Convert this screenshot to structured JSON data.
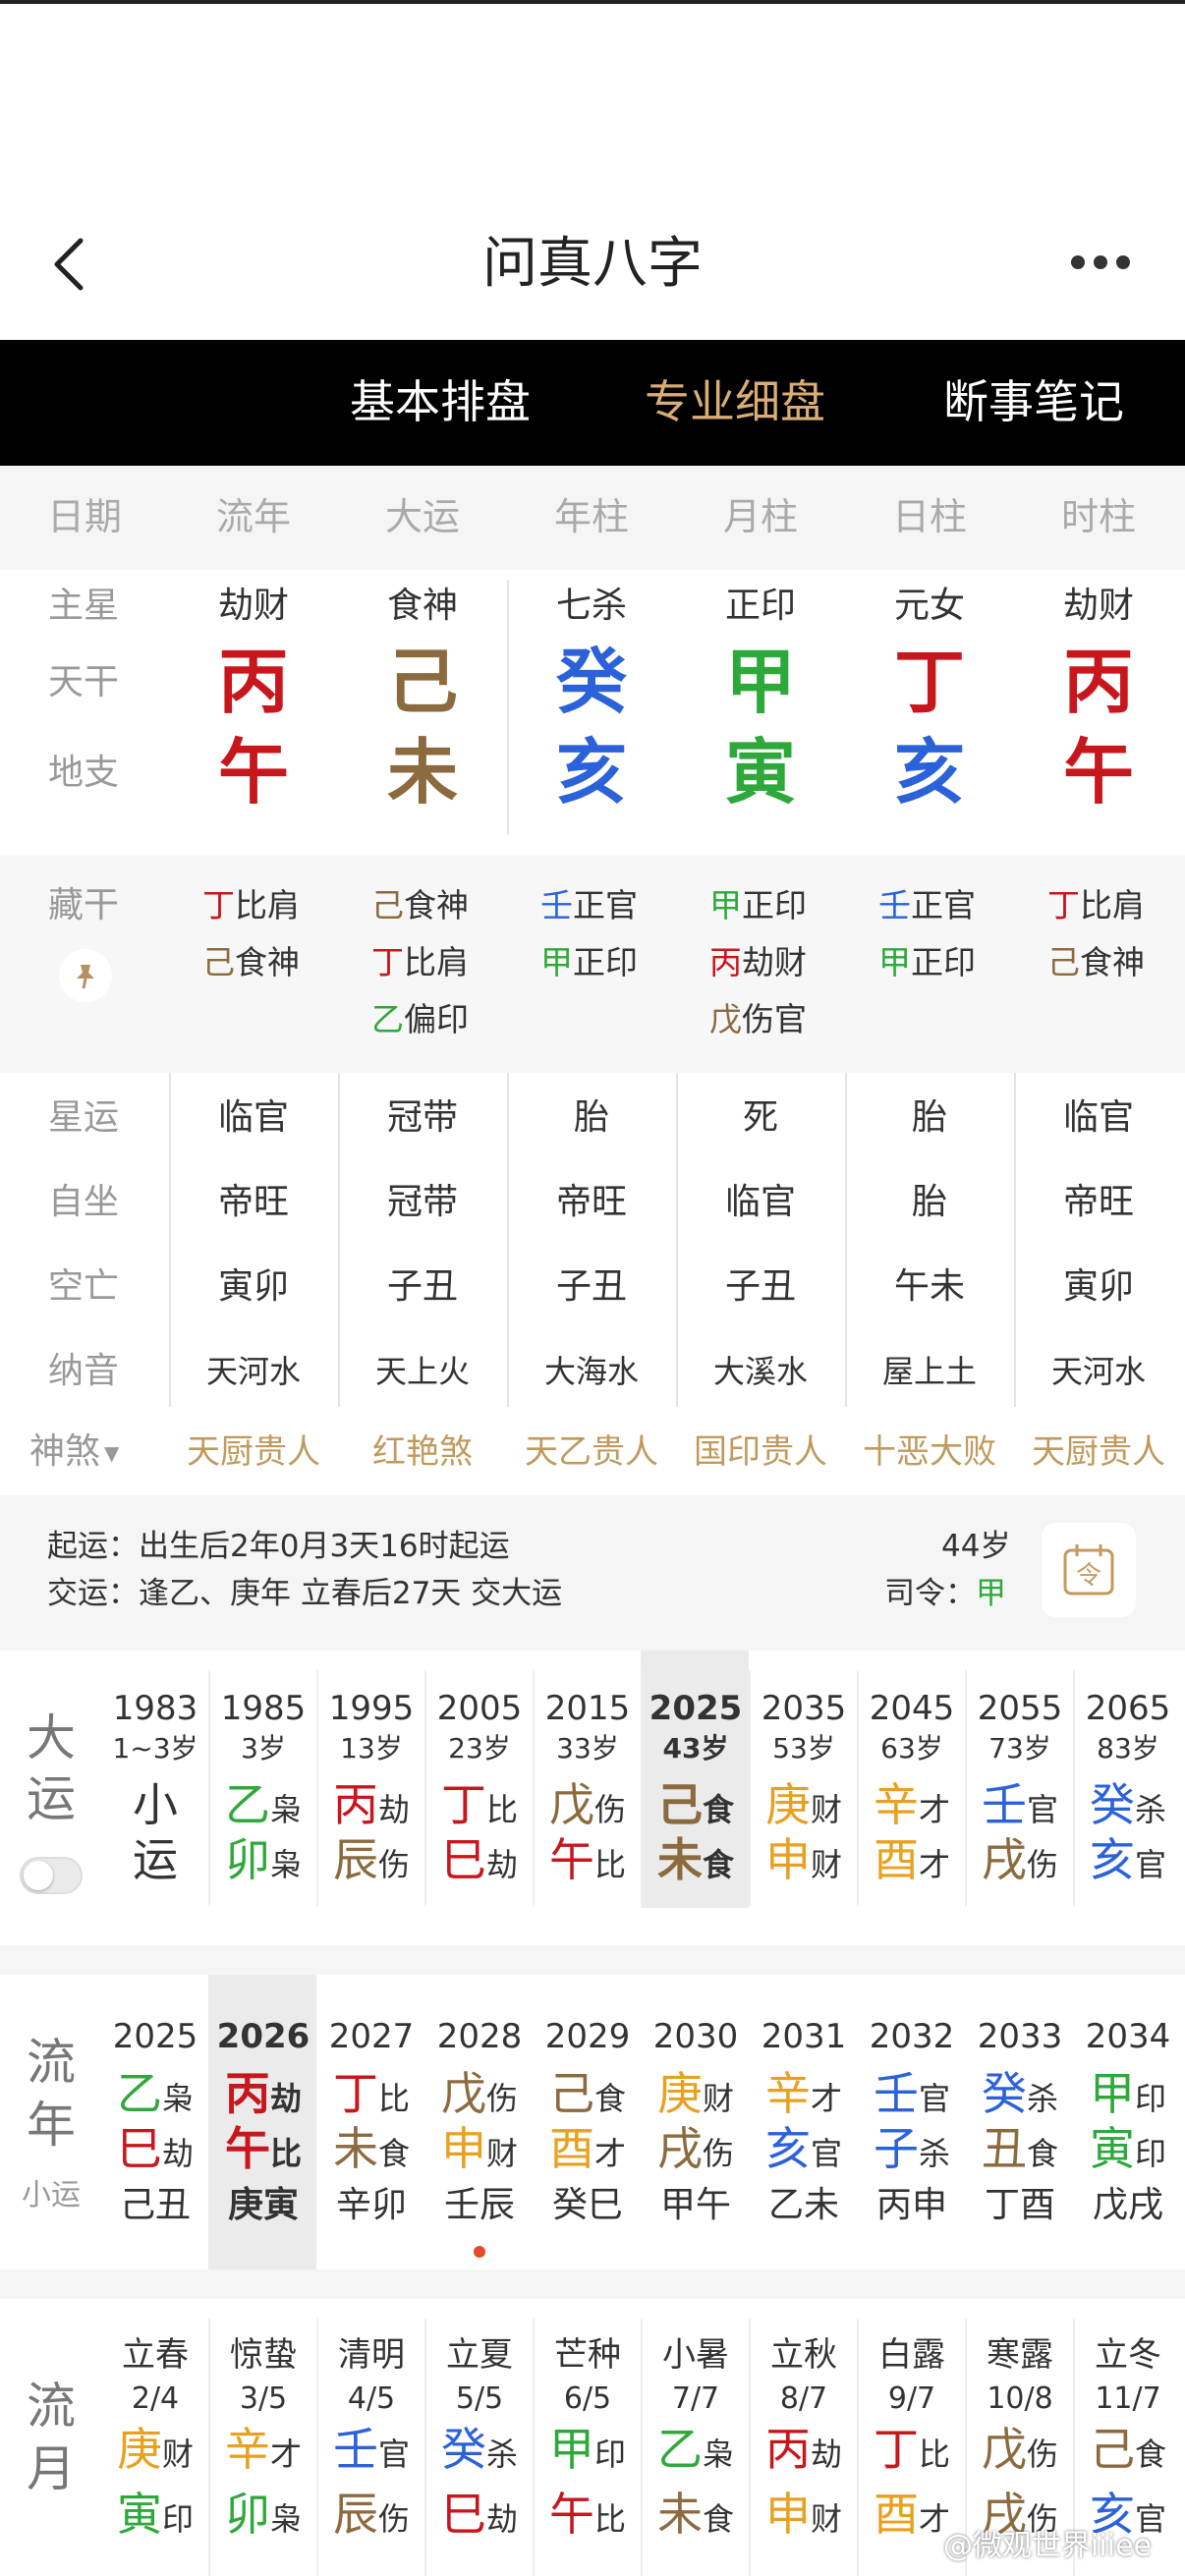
{
  "app_title": "问真八字",
  "tabs": [
    {
      "label": "",
      "active": false
    },
    {
      "label": "基本排盘",
      "active": false
    },
    {
      "label": "专业细盘",
      "active": true
    },
    {
      "label": "断事笔记",
      "active": false
    }
  ],
  "header": [
    "日期",
    "流年",
    "大运",
    "年柱",
    "月柱",
    "日柱",
    "时柱"
  ],
  "row_labels": {
    "zhuxing": "主星",
    "tiangan": "天干",
    "dizhi": "地支",
    "canggan": "藏干",
    "xingyun": "星运",
    "zizuo": "自坐",
    "kongwang": "空亡",
    "nayin": "纳音",
    "shensha": "神煞"
  },
  "pillars": [
    {
      "star": "劫财",
      "stem": "丙",
      "stem_color": "#c8161d",
      "branch": "午",
      "branch_color": "#c8161d"
    },
    {
      "star": "食神",
      "stem": "己",
      "stem_color": "#8b6a3e",
      "branch": "未",
      "branch_color": "#8b6a3e"
    },
    {
      "star": "七杀",
      "stem": "癸",
      "stem_color": "#2b62d9",
      "branch": "亥",
      "branch_color": "#2b62d9"
    },
    {
      "star": "正印",
      "stem": "甲",
      "stem_color": "#2ea83a",
      "branch": "寅",
      "branch_color": "#2ea83a"
    },
    {
      "star": "元女",
      "stem": "丁",
      "stem_color": "#c8161d",
      "branch": "亥",
      "branch_color": "#2b62d9"
    },
    {
      "star": "劫财",
      "stem": "丙",
      "stem_color": "#c8161d",
      "branch": "午",
      "branch_color": "#c8161d"
    }
  ],
  "hidden_stems": [
    [
      {
        "g": "丁",
        "c": "#c8161d",
        "t": "比肩"
      },
      {
        "g": "己",
        "c": "#8b6a3e",
        "t": "食神"
      }
    ],
    [
      {
        "g": "己",
        "c": "#8b6a3e",
        "t": "食神"
      },
      {
        "g": "丁",
        "c": "#c8161d",
        "t": "比肩"
      },
      {
        "g": "乙",
        "c": "#2ea83a",
        "t": "偏印"
      }
    ],
    [
      {
        "g": "壬",
        "c": "#2b62d9",
        "t": "正官"
      },
      {
        "g": "甲",
        "c": "#2ea83a",
        "t": "正印"
      }
    ],
    [
      {
        "g": "甲",
        "c": "#2ea83a",
        "t": "正印"
      },
      {
        "g": "丙",
        "c": "#c8161d",
        "t": "劫财"
      },
      {
        "g": "戊",
        "c": "#8b6a3e",
        "t": "伤官"
      }
    ],
    [
      {
        "g": "壬",
        "c": "#2b62d9",
        "t": "正官"
      },
      {
        "g": "甲",
        "c": "#2ea83a",
        "t": "正印"
      }
    ],
    [
      {
        "g": "丁",
        "c": "#c8161d",
        "t": "比肩"
      },
      {
        "g": "己",
        "c": "#8b6a3e",
        "t": "食神"
      }
    ]
  ],
  "xingyun": [
    "临官",
    "冠带",
    "胎",
    "死",
    "胎",
    "临官"
  ],
  "zizuo": [
    "帝旺",
    "冠带",
    "帝旺",
    "临官",
    "胎",
    "帝旺"
  ],
  "kongwang": [
    "寅卯",
    "子丑",
    "子丑",
    "子丑",
    "午未",
    "寅卯"
  ],
  "nayin": [
    "天河水",
    "天上火",
    "大海水",
    "大溪水",
    "屋上土",
    "天河水"
  ],
  "shensha": [
    "天厨贵人",
    "红艳煞",
    "天乙贵人",
    "国印贵人",
    "十恶大败",
    "天厨贵人"
  ],
  "qiyun": {
    "line1": "起运：出生后2年0月3天16时起运",
    "line2": "交运：逢乙、庚年 立春后27天 交大运",
    "age": "44岁",
    "siling_label": "司令：",
    "siling_value": "甲",
    "button_char": "令"
  },
  "dayun": {
    "side_label": [
      "大",
      "运"
    ],
    "items": [
      {
        "year": "1983",
        "age": "1~3岁",
        "xiaoyun": [
          "小",
          "运"
        ]
      },
      {
        "year": "1985",
        "age": "3岁",
        "g": "乙",
        "gc": "#2ea83a",
        "gt": "枭",
        "z": "卯",
        "zc": "#2ea83a",
        "zt": "枭"
      },
      {
        "year": "1995",
        "age": "13岁",
        "g": "丙",
        "gc": "#c8161d",
        "gt": "劫",
        "z": "辰",
        "zc": "#8b6a3e",
        "zt": "伤"
      },
      {
        "year": "2005",
        "age": "23岁",
        "g": "丁",
        "gc": "#c8161d",
        "gt": "比",
        "z": "巳",
        "zc": "#c8161d",
        "zt": "劫"
      },
      {
        "year": "2015",
        "age": "33岁",
        "g": "戊",
        "gc": "#8b6a3e",
        "gt": "伤",
        "z": "午",
        "zc": "#c8161d",
        "zt": "比"
      },
      {
        "year": "2025",
        "age": "43岁",
        "g": "己",
        "gc": "#8b6a3e",
        "gt": "食",
        "z": "未",
        "zc": "#8b6a3e",
        "zt": "食",
        "current": true
      },
      {
        "year": "2035",
        "age": "53岁",
        "g": "庚",
        "gc": "#e8a020",
        "gt": "财",
        "z": "申",
        "zc": "#e8a020",
        "zt": "财"
      },
      {
        "year": "2045",
        "age": "63岁",
        "g": "辛",
        "gc": "#e8a020",
        "gt": "才",
        "z": "酉",
        "zc": "#e8a020",
        "zt": "才"
      },
      {
        "year": "2055",
        "age": "73岁",
        "g": "壬",
        "gc": "#2b62d9",
        "gt": "官",
        "z": "戌",
        "zc": "#8b6a3e",
        "zt": "伤"
      },
      {
        "year": "2065",
        "age": "83岁",
        "g": "癸",
        "gc": "#2b62d9",
        "gt": "杀",
        "z": "亥",
        "zc": "#2b62d9",
        "zt": "官"
      }
    ]
  },
  "liunian": {
    "side_label": [
      "流",
      "年"
    ],
    "side_sub": "小运",
    "items": [
      {
        "year": "2025",
        "g": "乙",
        "gc": "#2ea83a",
        "gt": "枭",
        "z": "巳",
        "zc": "#c8161d",
        "zt": "劫",
        "xy": "己丑"
      },
      {
        "year": "2026",
        "g": "丙",
        "gc": "#c8161d",
        "gt": "劫",
        "z": "午",
        "zc": "#c8161d",
        "zt": "比",
        "xy": "庚寅",
        "current": true
      },
      {
        "year": "2027",
        "g": "丁",
        "gc": "#c8161d",
        "gt": "比",
        "z": "未",
        "zc": "#8b6a3e",
        "zt": "食",
        "xy": "辛卯"
      },
      {
        "year": "2028",
        "g": "戊",
        "gc": "#8b6a3e",
        "gt": "伤",
        "z": "申",
        "zc": "#e8a020",
        "zt": "财",
        "xy": "壬辰",
        "dot": true
      },
      {
        "year": "2029",
        "g": "己",
        "gc": "#8b6a3e",
        "gt": "食",
        "z": "酉",
        "zc": "#e8a020",
        "zt": "才",
        "xy": "癸巳"
      },
      {
        "year": "2030",
        "g": "庚",
        "gc": "#e8a020",
        "gt": "财",
        "z": "戌",
        "zc": "#8b6a3e",
        "zt": "伤",
        "xy": "甲午"
      },
      {
        "year": "2031",
        "g": "辛",
        "gc": "#e8a020",
        "gt": "才",
        "z": "亥",
        "zc": "#2b62d9",
        "zt": "官",
        "xy": "乙未"
      },
      {
        "year": "2032",
        "g": "壬",
        "gc": "#2b62d9",
        "gt": "官",
        "z": "子",
        "zc": "#2b62d9",
        "zt": "杀",
        "xy": "丙申"
      },
      {
        "year": "2033",
        "g": "癸",
        "gc": "#2b62d9",
        "gt": "杀",
        "z": "丑",
        "zc": "#8b6a3e",
        "zt": "食",
        "xy": "丁酉"
      },
      {
        "year": "2034",
        "g": "甲",
        "gc": "#2ea83a",
        "gt": "印",
        "z": "寅",
        "zc": "#2ea83a",
        "zt": "印",
        "xy": "戊戌"
      }
    ]
  },
  "liuyue": {
    "side_label": [
      "流",
      "月"
    ],
    "items": [
      {
        "term": "立春",
        "date": "2/4",
        "g": "庚",
        "gc": "#e8a020",
        "gt": "财",
        "z": "寅",
        "zc": "#2ea83a",
        "zt": "印"
      },
      {
        "term": "惊蛰",
        "date": "3/5",
        "g": "辛",
        "gc": "#e8a020",
        "gt": "才",
        "z": "卯",
        "zc": "#2ea83a",
        "zt": "枭"
      },
      {
        "term": "清明",
        "date": "4/5",
        "g": "壬",
        "gc": "#2b62d9",
        "gt": "官",
        "z": "辰",
        "zc": "#8b6a3e",
        "zt": "伤"
      },
      {
        "term": "立夏",
        "date": "5/5",
        "g": "癸",
        "gc": "#2b62d9",
        "gt": "杀",
        "z": "巳",
        "zc": "#c8161d",
        "zt": "劫"
      },
      {
        "term": "芒种",
        "date": "6/5",
        "g": "甲",
        "gc": "#2ea83a",
        "gt": "印",
        "z": "午",
        "zc": "#c8161d",
        "zt": "比"
      },
      {
        "term": "小暑",
        "date": "7/7",
        "g": "乙",
        "gc": "#2ea83a",
        "gt": "枭",
        "z": "未",
        "zc": "#8b6a3e",
        "zt": "食"
      },
      {
        "term": "立秋",
        "date": "8/7",
        "g": "丙",
        "gc": "#c8161d",
        "gt": "劫",
        "z": "申",
        "zc": "#e8a020",
        "zt": "财"
      },
      {
        "term": "白露",
        "date": "9/7",
        "g": "丁",
        "gc": "#c8161d",
        "gt": "比",
        "z": "酉",
        "zc": "#e8a020",
        "zt": "才"
      },
      {
        "term": "寒露",
        "date": "10/8",
        "g": "戊",
        "gc": "#8b6a3e",
        "gt": "伤",
        "z": "戌",
        "zc": "#8b6a3e",
        "zt": "伤"
      },
      {
        "term": "立冬",
        "date": "11/7",
        "g": "己",
        "gc": "#8b6a3e",
        "gt": "食",
        "z": "亥",
        "zc": "#2b62d9",
        "zt": "官"
      }
    ]
  },
  "watermark": "@微观世界iiiee"
}
